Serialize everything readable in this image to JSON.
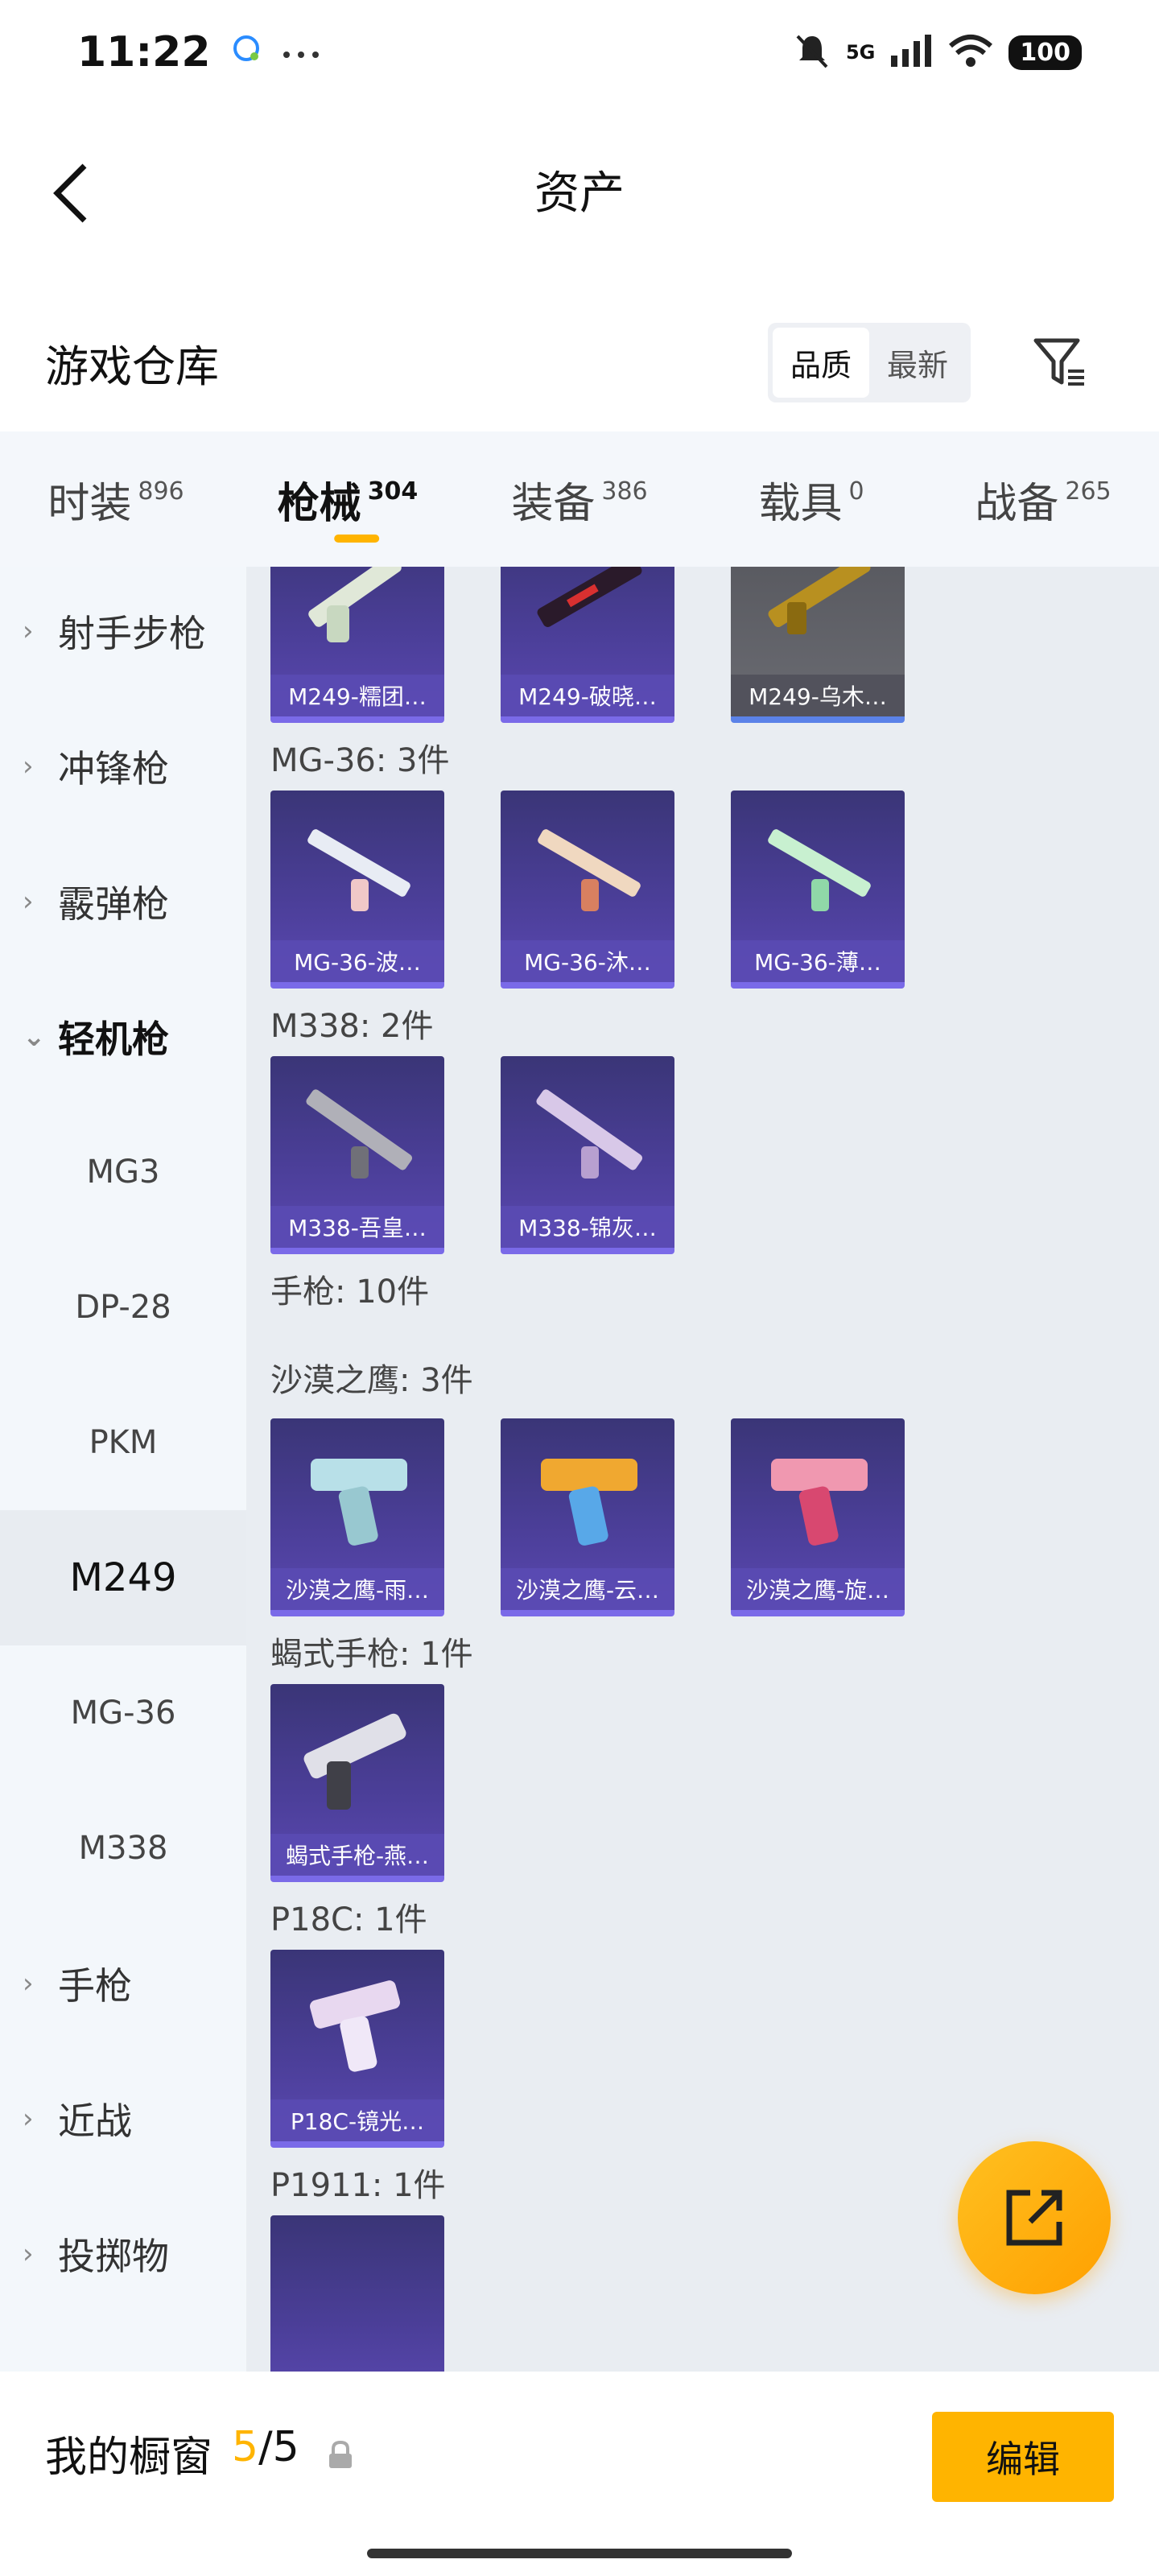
{
  "status_bar": {
    "time": "11:22",
    "network": "5G",
    "battery": "100"
  },
  "header": {
    "title": "资产"
  },
  "warehouse": {
    "title": "游戏仓库",
    "sort_options": [
      "品质",
      "最新"
    ],
    "active_sort": "品质"
  },
  "category_tabs": [
    {
      "label": "时装",
      "count": "896"
    },
    {
      "label": "枪械",
      "count": "304",
      "active": true
    },
    {
      "label": "装备",
      "count": "386"
    },
    {
      "label": "载具",
      "count": "0"
    },
    {
      "label": "战备",
      "count": "265"
    }
  ],
  "sidebar": {
    "items": [
      {
        "label": "射手步枪",
        "type": "parent"
      },
      {
        "label": "冲锋枪",
        "type": "parent"
      },
      {
        "label": "霰弹枪",
        "type": "parent"
      },
      {
        "label": "轻机枪",
        "type": "parent-open"
      },
      {
        "label": "MG3",
        "type": "child"
      },
      {
        "label": "DP-28",
        "type": "child"
      },
      {
        "label": "PKM",
        "type": "child"
      },
      {
        "label": "M249",
        "type": "child-active"
      },
      {
        "label": "MG-36",
        "type": "child"
      },
      {
        "label": "M338",
        "type": "child"
      },
      {
        "label": "手枪",
        "type": "parent"
      },
      {
        "label": "近战",
        "type": "parent"
      },
      {
        "label": "投掷物",
        "type": "parent"
      }
    ]
  },
  "content": {
    "m249_items": [
      "M249-糯团…",
      "M249-破晓…",
      "M249-乌木…"
    ],
    "mg36_label": "MG-36: 3件",
    "mg36_items": [
      "MG-36-波…",
      "MG-36-沐…",
      "MG-36-薄…"
    ],
    "m338_label": "M338: 2件",
    "m338_items": [
      "M338-吾皇…",
      "M338-锦灰…"
    ],
    "pistol_label": "手枪: 10件",
    "deagle_label": "沙漠之鹰: 3件",
    "deagle_items": [
      "沙漠之鹰-雨…",
      "沙漠之鹰-云…",
      "沙漠之鹰-旋…"
    ],
    "scorpion_label": "蝎式手枪: 1件",
    "scorpion_items": [
      "蝎式手枪-燕…"
    ],
    "p18c_label": "P18C: 1件",
    "p18c_items": [
      "P18C-镜光…"
    ],
    "p1911_label": "P1911: 1件"
  },
  "bottom_bar": {
    "showcase_label": "我的橱窗",
    "showcase_current": "5",
    "showcase_sep": "/",
    "showcase_max": "5",
    "edit_label": "编辑"
  },
  "colors": {
    "accent": "#ffb400",
    "card_bg": "#4c3f9a",
    "content_bg": "#e9edf2",
    "sidebar_bg": "#f3f7fb"
  },
  "icons": {
    "back": "chevron-left-icon",
    "filter": "filter-icon",
    "fab": "share-external-icon",
    "lock": "lock-icon"
  }
}
